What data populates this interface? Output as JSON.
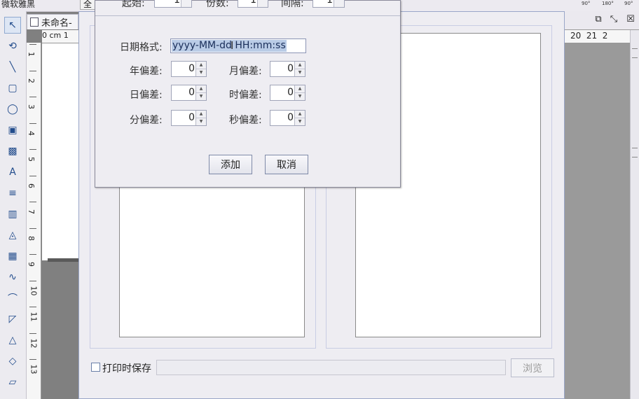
{
  "topbar": {
    "font_name": "微软雅黑",
    "button_partial": "全",
    "rotations": [
      "90°",
      "180°",
      "90°"
    ]
  },
  "document_tab": {
    "title": "未命名-"
  },
  "rulers": {
    "horizontal_left": "0 cm 1",
    "vertical": [
      "1",
      "2",
      "3",
      "4",
      "5",
      "6",
      "7",
      "8",
      "9",
      "10",
      "11",
      "12",
      "13"
    ],
    "horizontal_right": "20  21  2"
  },
  "window_buttons": [
    "restore",
    "minimize",
    "close"
  ],
  "back_dialog": {
    "print_save_label": "打印时保存",
    "path_value": "",
    "browse_label": "浏览"
  },
  "front_dialog": {
    "top_row": [
      {
        "label": "起始:",
        "value": "1"
      },
      {
        "label": "份数:",
        "value": "1"
      },
      {
        "label": "间隔:",
        "value": "1"
      }
    ],
    "format_label": "日期格式:",
    "format_value": "yyyy-MM-dd HH:mm:ss",
    "year_offset_label": "年偏差:",
    "year_offset_value": "0",
    "month_offset_label": "月偏差:",
    "month_offset_value": "0",
    "day_offset_label": "日偏差:",
    "day_offset_value": "0",
    "hour_offset_label": "时偏差:",
    "hour_offset_value": "0",
    "minute_offset_label": "分偏差:",
    "minute_offset_value": "0",
    "second_offset_label": "秒偏差:",
    "second_offset_value": "0",
    "add_button": "添加",
    "cancel_button": "取消"
  },
  "tools": [
    "pointer-icon",
    "rotate-icon",
    "line-icon",
    "rectangle-icon",
    "ellipse-icon",
    "image-icon",
    "picture-icon",
    "text-icon",
    "rich-text-icon",
    "barcode-icon",
    "triangle-shape-icon",
    "qrcode-icon",
    "curve-icon",
    "arc-icon",
    "polygon-icon",
    "triangle-icon",
    "diamond-icon",
    "parallelogram-icon"
  ],
  "tool_glyphs": [
    "↖",
    "⟲",
    "╲",
    "▢",
    "◯",
    "▣",
    "▩",
    "A",
    "≡",
    "▥",
    "◬",
    "▦",
    "∿",
    "⌒",
    "◸",
    "△",
    "◇",
    "▱"
  ],
  "colors": {
    "selection": "#b9cbe6",
    "dialog_bg": "#eeedf2",
    "accent_border": "#7f8aa8"
  }
}
